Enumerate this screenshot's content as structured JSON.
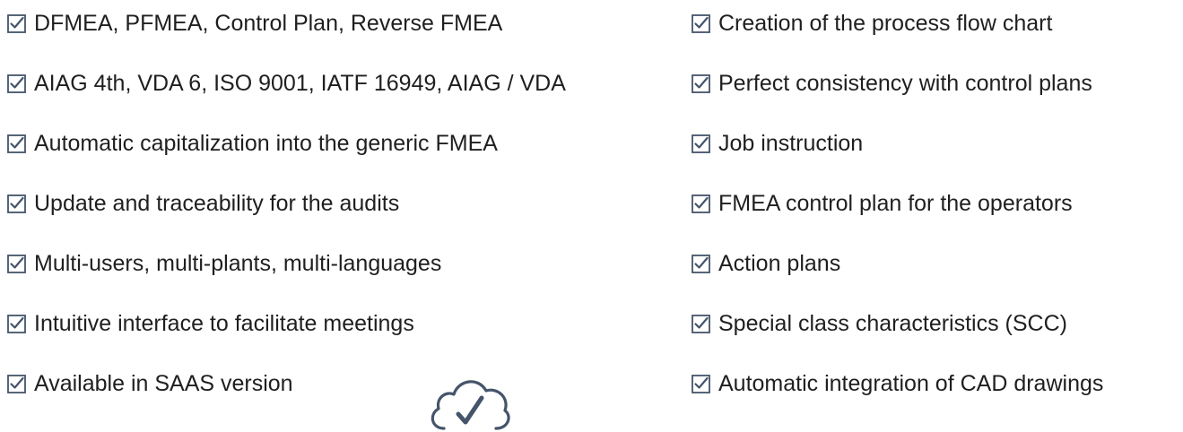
{
  "colors": {
    "text": "#1f1f1f",
    "icon": "#44546a"
  },
  "left_features": [
    "DFMEA, PFMEA, Control Plan, Reverse FMEA",
    "AIAG 4th, VDA 6, ISO 9001, IATF 16949, AIAG / VDA",
    "Automatic capitalization into the generic FMEA",
    "Update and traceability for the audits",
    "Multi-users, multi-plants, multi-languages",
    "Intuitive interface to facilitate meetings",
    "Available in SAAS version"
  ],
  "right_features": [
    "Creation of the process flow chart",
    "Perfect consistency with control plans",
    "Job instruction",
    "FMEA control plan for the operators",
    "Action plans",
    "Special class characteristics (SCC)",
    "Automatic integration of CAD drawings"
  ],
  "icons": {
    "checkbox": "checkbox-checked-icon",
    "cloud": "cloud-check-icon"
  }
}
